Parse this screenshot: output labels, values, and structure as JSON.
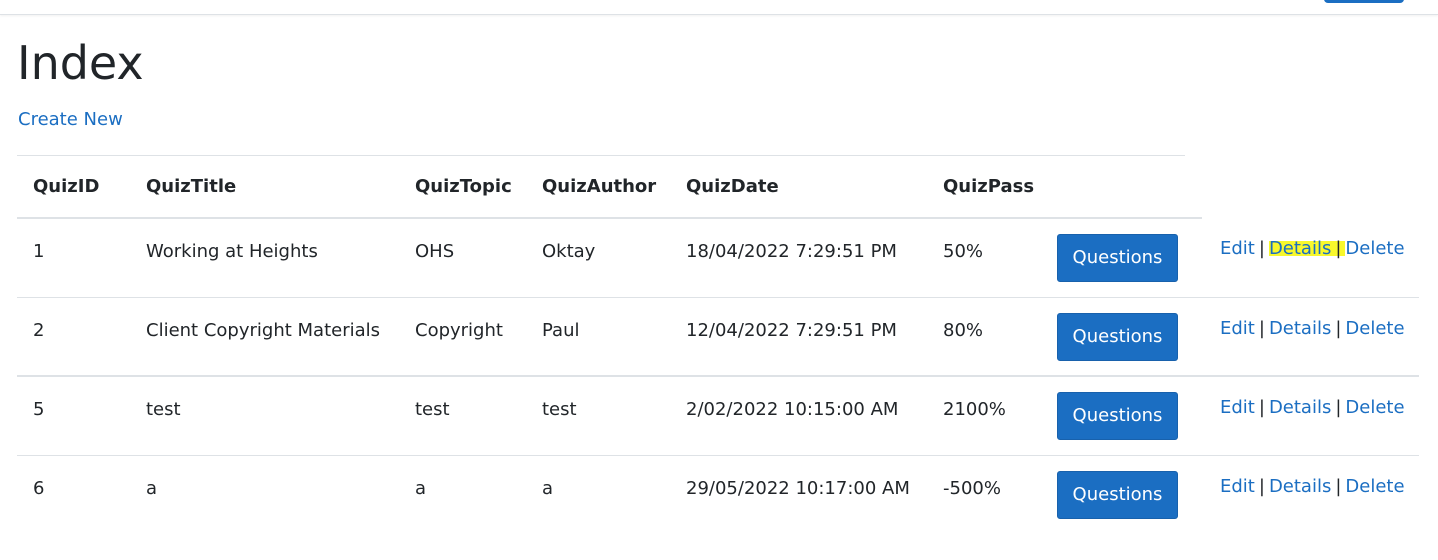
{
  "page": {
    "title": "Index",
    "create_new_label": "Create New"
  },
  "table": {
    "headers": {
      "id": "QuizID",
      "title": "QuizTitle",
      "topic": "QuizTopic",
      "author": "QuizAuthor",
      "date": "QuizDate",
      "pass": "QuizPass"
    },
    "rows": [
      {
        "id": "1",
        "title": "Working at Heights",
        "topic": "OHS",
        "author": "Oktay",
        "date": "18/04/2022 7:29:51 PM",
        "pass": "50%"
      },
      {
        "id": "2",
        "title": "Client Copyright Materials",
        "topic": "Copyright",
        "author": "Paul",
        "date": "12/04/2022 7:29:51 PM",
        "pass": "80%"
      },
      {
        "id": "5",
        "title": "test",
        "topic": "test",
        "author": "test",
        "date": "2/02/2022 10:15:00 AM",
        "pass": "2100%"
      },
      {
        "id": "6",
        "title": "a",
        "topic": "a",
        "author": "a",
        "date": "29/05/2022 10:17:00 AM",
        "pass": "-500%"
      }
    ],
    "actions": {
      "questions_label": "Questions",
      "edit_label": "Edit",
      "details_label": "Details",
      "delete_label": "Delete",
      "separator": "|"
    }
  },
  "colors": {
    "link": "#1b6ec2",
    "button": "#1b6ec2",
    "highlight": "#f8f82c"
  }
}
